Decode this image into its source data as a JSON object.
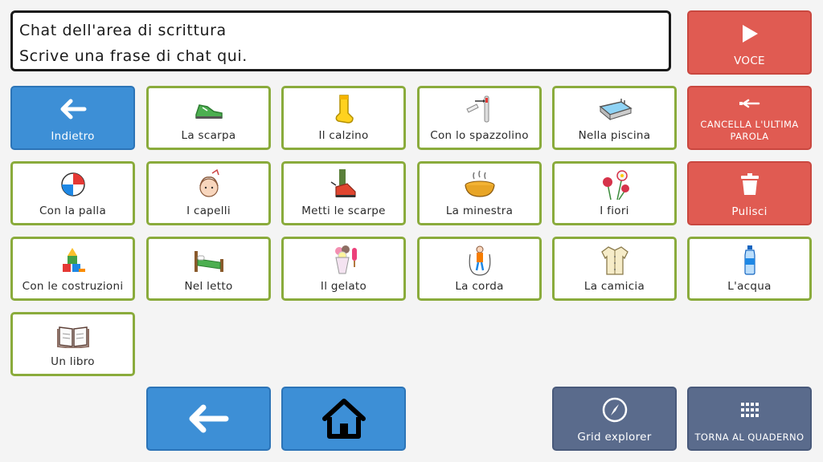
{
  "writing_area": {
    "line1": "Chat dell'area di scrittura",
    "line2": "Scrive una frase di chat qui."
  },
  "actions": {
    "speak": {
      "label": "VOCE",
      "icon": "play-icon"
    },
    "delete_last_word": {
      "label": "CANCELLA L'ULTIMA PAROLA",
      "icon": "backspace-icon"
    },
    "clear": {
      "label": "Pulisci",
      "icon": "trash-icon"
    }
  },
  "nav": {
    "back": {
      "label": "Indietro",
      "icon": "arrow-left-icon"
    },
    "bottom_back": {
      "icon": "arrow-left-icon"
    },
    "home": {
      "icon": "home-icon"
    },
    "grid_explorer": {
      "label": "Grid explorer",
      "icon": "compass-icon"
    },
    "back_to_notebook": {
      "label": "TORNA AL QUADERNO",
      "icon": "grid-icon"
    }
  },
  "words": [
    {
      "label": "La scarpa",
      "icon": "shoe-icon"
    },
    {
      "label": "Il calzino",
      "icon": "sock-icon"
    },
    {
      "label": "Con lo spazzolino",
      "icon": "toothbrush-icon"
    },
    {
      "label": "Nella piscina",
      "icon": "pool-icon"
    },
    {
      "label": "Con la palla",
      "icon": "ball-icon"
    },
    {
      "label": "I capelli",
      "icon": "hair-icon"
    },
    {
      "label": "Metti le scarpe",
      "icon": "put-on-shoes-icon"
    },
    {
      "label": "La minestra",
      "icon": "soup-icon"
    },
    {
      "label": "I fiori",
      "icon": "flowers-icon"
    },
    {
      "label": "Con le costruzioni",
      "icon": "building-blocks-icon"
    },
    {
      "label": "Nel letto",
      "icon": "bed-icon"
    },
    {
      "label": "Il gelato",
      "icon": "ice-cream-icon"
    },
    {
      "label": "La corda",
      "icon": "jump-rope-icon"
    },
    {
      "label": "La camicia",
      "icon": "shirt-icon"
    },
    {
      "label": "L'acqua",
      "icon": "water-bottle-icon"
    },
    {
      "label": "Un libro",
      "icon": "book-icon"
    }
  ],
  "colors": {
    "word_border": "#8aab3c",
    "nav_blue": "#3d8fd6",
    "action_red": "#e05b52",
    "dark_slate": "#5a6b8c"
  }
}
